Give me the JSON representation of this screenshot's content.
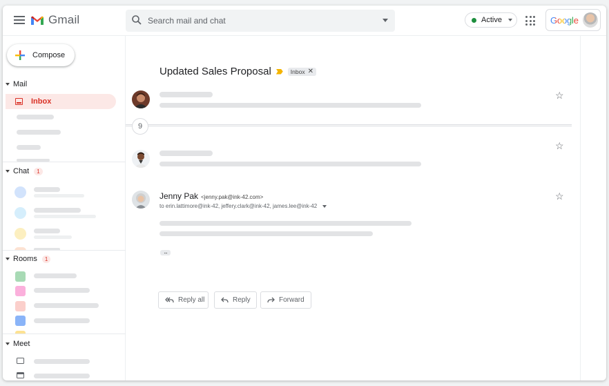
{
  "app": {
    "name": "Gmail"
  },
  "search": {
    "placeholder": "Search mail and chat"
  },
  "status": {
    "label": "Active",
    "color": "#1e8e3e"
  },
  "account": {
    "brand": "Google"
  },
  "compose": {
    "label": "Compose"
  },
  "sidebar": {
    "mail": {
      "label": "Mail",
      "inbox_label": "Inbox"
    },
    "chat": {
      "label": "Chat",
      "badge": "1"
    },
    "rooms": {
      "label": "Rooms",
      "badge": "1"
    },
    "meet": {
      "label": "Meet"
    }
  },
  "thread": {
    "subject": "Updated Sales Proposal",
    "label_chip": "Inbox",
    "collapsed_count": "9",
    "last_message": {
      "sender_name": "Jenny Pak",
      "sender_email": "<jenny.pak@ink-42.com>",
      "recipients": "to erin.lattimore@ink-42, jeffery.clark@ink-42, james.lee@ink-42"
    }
  },
  "actions": {
    "reply_all": "Reply all",
    "reply": "Reply",
    "forward": "Forward"
  },
  "colors": {
    "accent": "#d93025",
    "inbox_bg": "#fce8e6",
    "importance": "#f4b400"
  }
}
